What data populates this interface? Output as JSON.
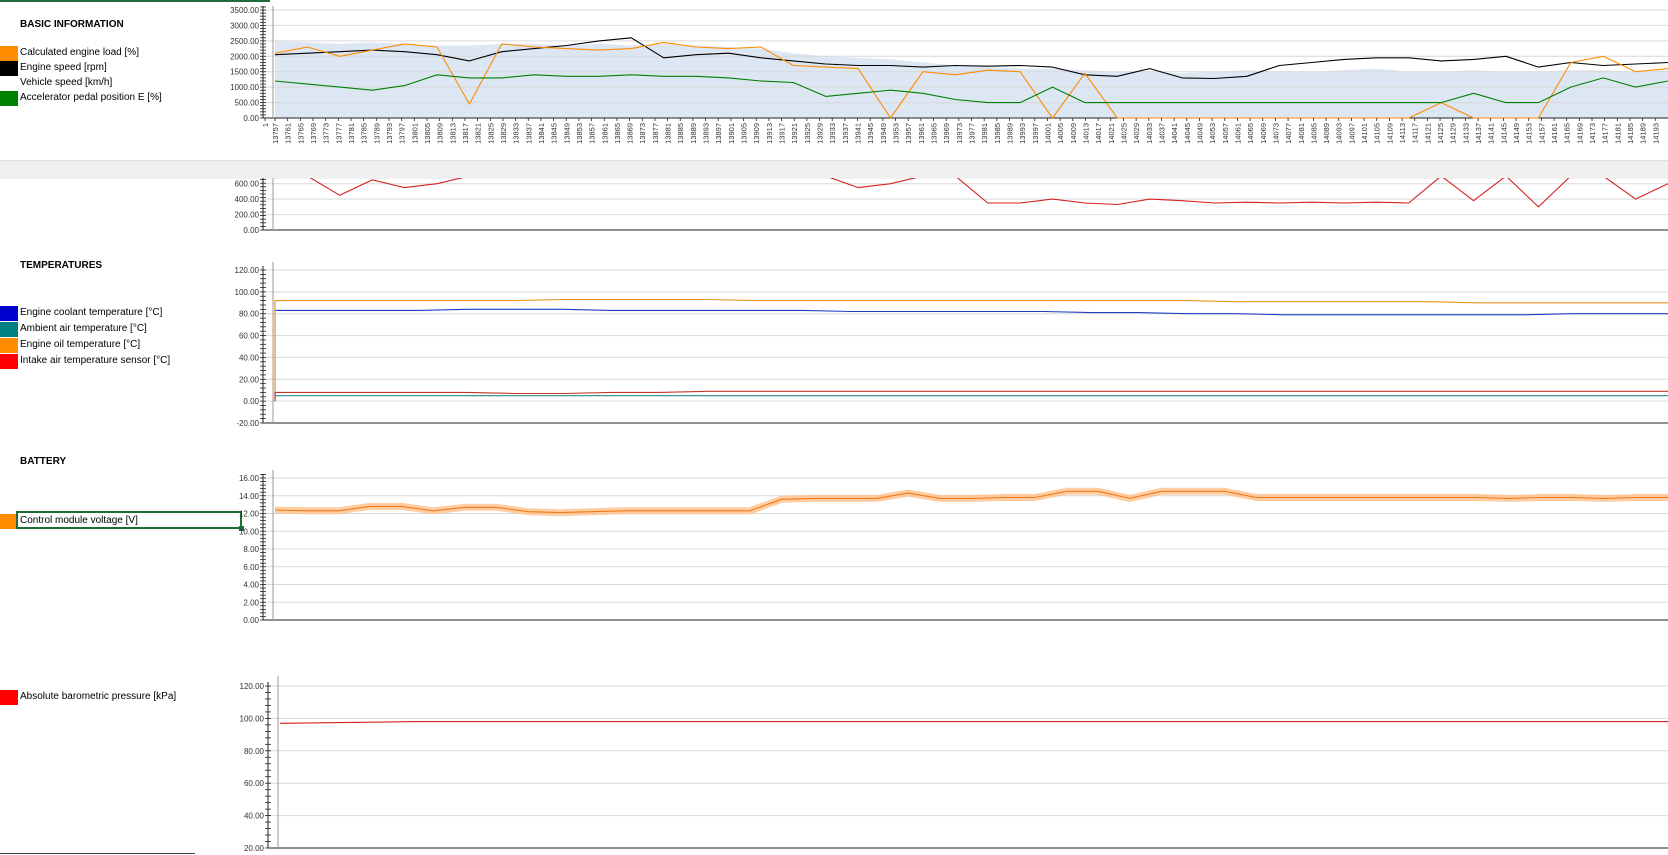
{
  "sections": {
    "basic": {
      "title": "BASIC INFORMATION",
      "legend": [
        {
          "label": "Calculated engine load [%]",
          "color": "#ff8c00"
        },
        {
          "label": "Engine speed [rpm]",
          "color": "#000000"
        },
        {
          "label": "Vehicle speed [km/h]",
          "color": "#ffffff"
        },
        {
          "label": "Accelerator pedal position E [%]",
          "color": "#008000"
        }
      ]
    },
    "temperatures": {
      "title": "TEMPERATURES",
      "legend": [
        {
          "label": "Engine coolant temperature [°C]",
          "color": "#0000cc"
        },
        {
          "label": "Ambient air temperature [°C]",
          "color": "#008080"
        },
        {
          "label": "Engine oil temperature [°C]",
          "color": "#ff8c00"
        },
        {
          "label": "Intake air temperature sensor [°C]",
          "color": "#ff0000"
        }
      ]
    },
    "battery": {
      "title": "BATTERY",
      "legend": [
        {
          "label": "Control module voltage [V]",
          "color": "#ff8c00"
        }
      ]
    },
    "pressure": {
      "legend": [
        {
          "label": "Absolute barometric pressure [kPa]",
          "color": "#ff0000"
        }
      ]
    }
  },
  "chart_data": [
    {
      "type": "line",
      "ylim": [
        0,
        3500
      ],
      "yticks": [
        "0.00",
        "500.00",
        "1000.00",
        "1500.00",
        "2000.00",
        "2500.00",
        "3000.00",
        "3500.00"
      ],
      "x_ticks": [
        "1",
        "13757",
        "13761",
        "13765",
        "13769",
        "13773",
        "13777",
        "13781",
        "13785",
        "13789",
        "13793",
        "13797",
        "13801",
        "13805",
        "13809",
        "13813",
        "13817",
        "13821",
        "13825",
        "13829",
        "13833",
        "13837",
        "13841",
        "13845",
        "13849",
        "13853",
        "13857",
        "13861",
        "13865",
        "13869",
        "13873",
        "13877",
        "13881",
        "13885",
        "13889",
        "13893",
        "13897",
        "13901",
        "13905",
        "13909",
        "13913",
        "13917",
        "13921",
        "13925",
        "13929",
        "13933",
        "13937",
        "13941",
        "13945",
        "13949",
        "13953",
        "13957",
        "13961",
        "13965",
        "13969",
        "13973",
        "13977",
        "13981",
        "13985",
        "13989",
        "13993",
        "13997",
        "14001",
        "14005",
        "14009",
        "14013",
        "14017",
        "14021",
        "14025",
        "14029",
        "14033",
        "14037",
        "14041",
        "14045",
        "14049",
        "14053",
        "14057",
        "14061",
        "14065",
        "14069",
        "14073",
        "14077",
        "14081",
        "14085",
        "14089",
        "14093",
        "14097",
        "14101",
        "14105",
        "14109",
        "14113",
        "14117",
        "14121",
        "14125",
        "14129",
        "14133",
        "14137",
        "14141",
        "14145",
        "14149",
        "14153",
        "14157",
        "14161",
        "14165",
        "14169",
        "14173",
        "14177",
        "14181",
        "14185",
        "14189",
        "14193"
      ],
      "series": [
        {
          "name": "Engine speed [rpm]",
          "values": [
            2050,
            2100,
            2150,
            2200,
            2150,
            2050,
            1850,
            2150,
            2250,
            2350,
            2500,
            2600,
            1950,
            2050,
            2100,
            1950,
            1850,
            1750,
            1700,
            1700,
            1650,
            1700,
            1680,
            1700,
            1650,
            1400,
            1350,
            1600,
            1300,
            1280,
            1350,
            1700,
            1800,
            1900,
            1950,
            1950,
            1850,
            1900,
            2000,
            1650,
            1800,
            1700,
            1750,
            1800
          ]
        },
        {
          "name": "Calculated engine load [%]",
          "values": [
            2100,
            2300,
            2000,
            2200,
            2400,
            2300,
            450,
            2400,
            2300,
            2250,
            2200,
            2250,
            2450,
            2300,
            2250,
            2300,
            1700,
            1650,
            1600,
            0,
            1500,
            1400,
            1550,
            1500,
            0,
            1450,
            0,
            0,
            0,
            0,
            0,
            0,
            0,
            0,
            0,
            0,
            500,
            0,
            0,
            0,
            1800,
            2000,
            1500,
            1600
          ]
        },
        {
          "name": "Vehicle speed [km/h]",
          "values": [
            2500,
            2450,
            2400,
            2450,
            2400,
            2350,
            2350,
            2400,
            2400,
            2350,
            2400,
            2350,
            2400,
            2350,
            2300,
            2250,
            2100,
            2000,
            1950,
            1900,
            1800,
            1700,
            1650,
            1600,
            1600,
            1550,
            1500,
            1500,
            1450,
            1500,
            1550,
            1500,
            1500,
            1550,
            1600,
            1500,
            1500,
            1550,
            1500,
            1500,
            1550,
            1550,
            1500,
            1550
          ]
        },
        {
          "name": "Accelerator pedal position E [%]",
          "values": [
            1200,
            1100,
            1000,
            900,
            1050,
            1400,
            1300,
            1300,
            1400,
            1350,
            1350,
            1400,
            1350,
            1350,
            1300,
            1200,
            1150,
            700,
            800,
            900,
            800,
            600,
            500,
            500,
            1000,
            500,
            500,
            500,
            500,
            500,
            500,
            500,
            500,
            500,
            500,
            500,
            500,
            800,
            500,
            500,
            1000,
            1300,
            1000,
            1200
          ]
        }
      ]
    },
    {
      "type": "line",
      "ylim": [
        0,
        700
      ],
      "yticks": [
        "0.00",
        "200.00",
        "400.00",
        "600.00"
      ],
      "series": [
        {
          "name": "",
          "values": [
            700,
            700,
            450,
            650,
            550,
            600,
            700,
            700,
            700,
            700,
            700,
            700,
            700,
            700,
            700,
            700,
            700,
            700,
            550,
            600,
            700,
            700,
            350,
            350,
            400,
            350,
            330,
            400,
            380,
            350,
            360,
            350,
            360,
            350,
            360,
            350,
            700,
            380,
            700,
            300,
            700,
            700,
            400,
            600
          ]
        }
      ]
    },
    {
      "type": "line",
      "ylim": [
        -20,
        120
      ],
      "yticks": [
        "-20.00",
        "0.00",
        "20.00",
        "40.00",
        "60.00",
        "80.00",
        "100.00",
        "120.00"
      ],
      "series": [
        {
          "name": "Engine coolant temperature [°C]",
          "values": [
            83,
            83,
            83,
            83,
            84,
            84,
            84,
            83,
            83,
            83,
            83,
            83,
            82,
            82,
            82,
            82,
            82,
            81,
            81,
            80,
            80,
            79,
            79,
            79,
            79,
            79,
            79,
            80,
            80,
            80
          ]
        },
        {
          "name": "Ambient air temperature [°C]",
          "values": [
            5,
            5,
            5,
            5,
            5,
            5,
            5,
            5,
            5,
            5,
            5,
            5,
            5,
            5,
            5,
            5,
            5,
            5,
            5,
            5,
            5,
            5,
            5,
            5,
            5,
            5,
            5,
            5,
            5,
            5
          ]
        },
        {
          "name": "Engine oil temperature [°C]",
          "values": [
            92,
            92,
            92,
            92,
            92,
            92,
            93,
            93,
            93,
            93,
            92,
            92,
            92,
            92,
            92,
            92,
            92,
            92,
            92,
            92,
            91,
            91,
            91,
            91,
            91,
            90,
            90,
            90,
            90,
            90
          ]
        },
        {
          "name": "Intake air temperature sensor [°C]",
          "values": [
            8,
            8,
            8,
            8,
            8,
            7,
            7,
            8,
            8,
            9,
            9,
            9,
            9,
            9,
            9,
            9,
            9,
            9,
            9,
            9,
            9,
            9,
            9,
            9,
            9,
            9,
            9,
            9,
            9,
            9
          ]
        }
      ]
    },
    {
      "type": "line",
      "ylim": [
        0,
        16
      ],
      "yticks": [
        "0.00",
        "2.00",
        "4.00",
        "6.00",
        "8.00",
        "10.00",
        "12.00",
        "14.00",
        "16.00"
      ],
      "series": [
        {
          "name": "Control module voltage [V]",
          "values": [
            12.4,
            12.3,
            12.3,
            12.8,
            12.8,
            12.3,
            12.7,
            12.7,
            12.2,
            12.1,
            12.2,
            12.3,
            12.3,
            12.3,
            12.3,
            12.3,
            13.6,
            13.7,
            13.7,
            13.7,
            14.3,
            13.7,
            13.7,
            13.8,
            13.8,
            14.5,
            14.5,
            13.7,
            14.5,
            14.5,
            14.5,
            13.8,
            13.8,
            13.8,
            13.8,
            13.8,
            13.8,
            13.8,
            13.8,
            13.7,
            13.8,
            13.8,
            13.7,
            13.8,
            13.8
          ]
        }
      ]
    },
    {
      "type": "line",
      "ylim": [
        20,
        120
      ],
      "yticks": [
        "20.00",
        "40.00",
        "60.00",
        "80.00",
        "100.00",
        "120.00"
      ],
      "series": [
        {
          "name": "Absolute barometric pressure [kPa]",
          "values": [
            97,
            98,
            98,
            98,
            98,
            98,
            98,
            98,
            98,
            98,
            98
          ]
        }
      ]
    }
  ]
}
